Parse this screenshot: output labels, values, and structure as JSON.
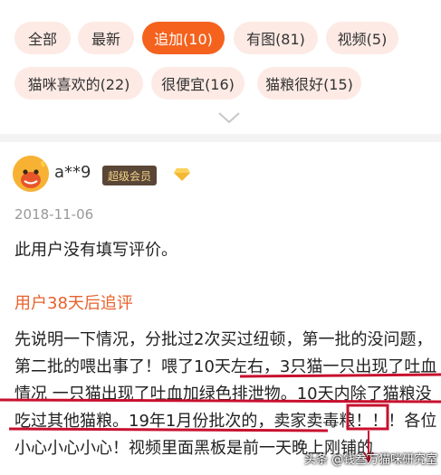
{
  "filter_tags": {
    "all": "全部",
    "latest": "最新",
    "followup": "追加(10)",
    "with_images": "有图(81)",
    "video": "视频(5)",
    "cat_loves": "猫咪喜欢的(22)",
    "cheap": "很便宜(16)",
    "good_food": "猫粮很好(15)"
  },
  "review": {
    "username": "a**9",
    "member_badge": "超级会员",
    "date": "2018-11-06",
    "text": "此用户没有填写评价。",
    "followup_title": "用户38天后追评",
    "followup_body": "先说明一下情况，分批过2次买过纽顿，第一批的没问题，第二批的喂出事了！喂了10天左右，3只猫一只出现了吐血情况 一只猫出现了吐血加绿色排泄物。10天内除了猫粮没吃过其他猫粮。19年1月份批次的，卖家卖毒粮！！！各位小心小心小心！视频里面黑板是前一天晚上刚铺的"
  },
  "watermark": "头条 @钱叁万猫咪研究室",
  "colors": {
    "accent": "#f4621e",
    "tag_bg": "#fdeae4",
    "followup_title": "#e8612c",
    "annotation": "#c8102e"
  }
}
